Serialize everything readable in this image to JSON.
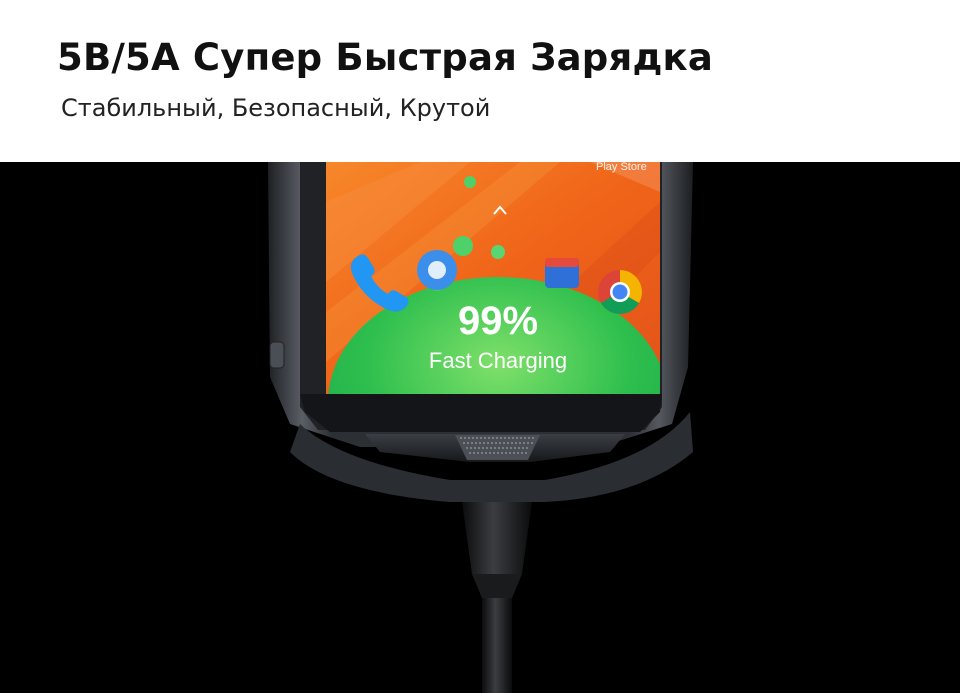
{
  "header": {
    "title": "5В/5А Супер Быстрая Зарядка",
    "subtitle": "Стабильный, Безопасный, Крутой"
  },
  "phone_screen": {
    "store_label": "Play Store",
    "battery_percent": "99%",
    "charging_label": "Fast Charging",
    "battery_level": 0.99
  },
  "colors": {
    "wallpaper_orange": "#f26a1b",
    "charge_green": "#33c44a",
    "device_body": "#3a3d42"
  },
  "icons": [
    "phone-app-icon",
    "messages-app-icon",
    "gallery-app-icon",
    "chrome-icon",
    "chevron-up-icon",
    "usb-cable"
  ]
}
